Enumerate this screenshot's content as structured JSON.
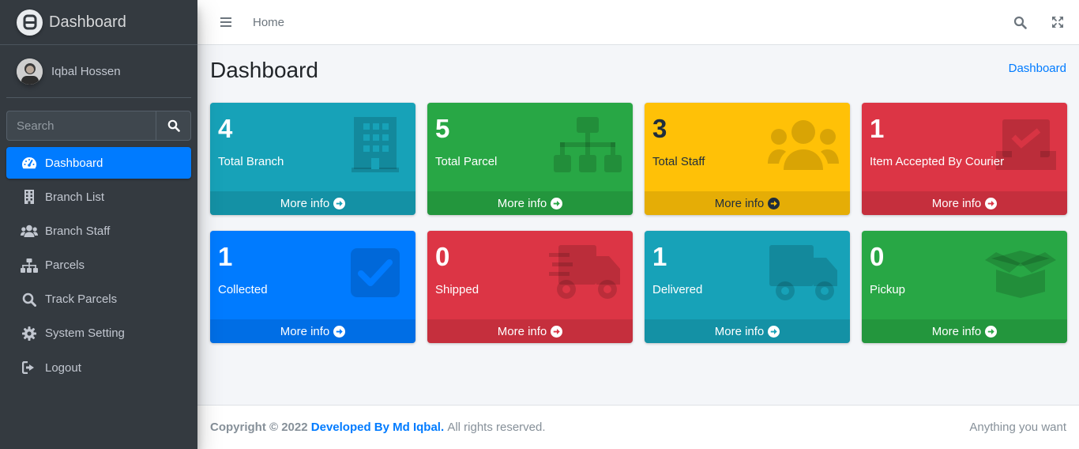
{
  "brand": {
    "name": "Dashboard"
  },
  "user": {
    "name": "Iqbal Hossen"
  },
  "search": {
    "placeholder": "Search"
  },
  "sidebar": {
    "items": [
      {
        "label": "Dashboard",
        "icon": "tachometer-icon",
        "active": true
      },
      {
        "label": "Branch List",
        "icon": "building-icon"
      },
      {
        "label": "Branch Staff",
        "icon": "users-icon"
      },
      {
        "label": "Parcels",
        "icon": "sitemap-icon"
      },
      {
        "label": "Track Parcels",
        "icon": "search-icon"
      },
      {
        "label": "System Setting",
        "icon": "gear-icon"
      },
      {
        "label": "Logout",
        "icon": "sign-out-icon"
      }
    ]
  },
  "topbar": {
    "home": "Home"
  },
  "page": {
    "title": "Dashboard",
    "breadcrumb": "Dashboard"
  },
  "colors": {
    "info": "#17a2b8",
    "success": "#28a745",
    "warning": "#ffc107",
    "danger": "#dc3545",
    "primary": "#007bff",
    "sidebar": "#343a40"
  },
  "boxes": [
    {
      "count": "4",
      "label": "Total Branch",
      "more": "More info",
      "color": "info",
      "icon": "building-icon"
    },
    {
      "count": "5",
      "label": "Total Parcel",
      "more": "More info",
      "color": "success",
      "icon": "sitemap-icon"
    },
    {
      "count": "3",
      "label": "Total Staff",
      "more": "More info",
      "color": "warning",
      "icon": "users-icon"
    },
    {
      "count": "1",
      "label": "Item Accepted By Courier",
      "more": "More info",
      "color": "danger",
      "icon": "inbox-check-icon"
    },
    {
      "count": "1",
      "label": "Collected",
      "more": "More info",
      "color": "primary",
      "icon": "check-square-icon"
    },
    {
      "count": "0",
      "label": "Shipped",
      "more": "More info",
      "color": "danger",
      "icon": "shipping-fast-icon"
    },
    {
      "count": "1",
      "label": "Delivered",
      "more": "More info",
      "color": "info",
      "icon": "truck-icon"
    },
    {
      "count": "0",
      "label": "Pickup",
      "more": "More info",
      "color": "success",
      "icon": "box-open-icon"
    }
  ],
  "footer": {
    "copyright": "Copyright © 2022",
    "developer": "Developed By Md Iqbal.",
    "rights": "All rights reserved.",
    "right_text": "Anything you want"
  }
}
